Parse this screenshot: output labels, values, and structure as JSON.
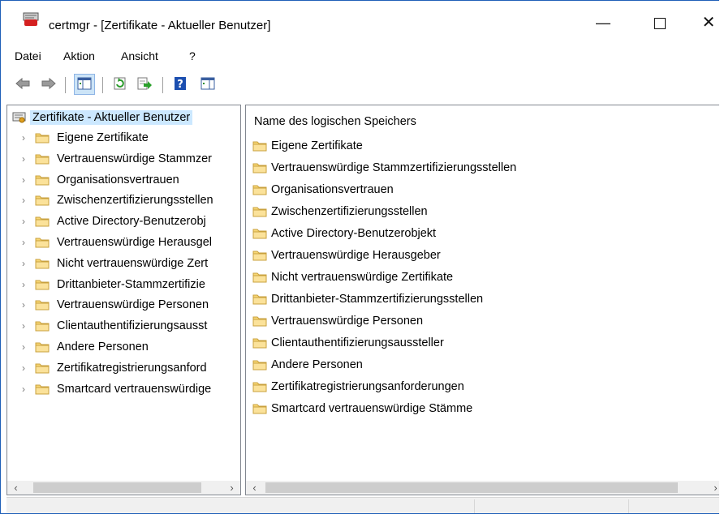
{
  "window": {
    "title": "certmgr - [Zertifikate - Aktueller Benutzer]",
    "controls": [
      "minimize-icon",
      "maximize-icon",
      "close-icon"
    ]
  },
  "menu": [
    "Datei",
    "Aktion",
    "Ansicht",
    "?"
  ],
  "toolbar": {
    "icons": [
      "back-arrow-icon",
      "forward-arrow-icon",
      "show-hide-tree-icon",
      "refresh-icon",
      "export-list-icon",
      "help-icon",
      "action-pane-icon"
    ]
  },
  "tree": {
    "root": "Zertifikate - Aktueller Benutzer",
    "items": [
      "Eigene Zertifikate",
      "Vertrauenswürdige Stammzer",
      "Organisationsvertrauen",
      "Zwischenzertifizierungsstellen",
      "Active Directory-Benutzerobj",
      "Vertrauenswürdige Herausgel",
      "Nicht vertrauenswürdige Zert",
      "Drittanbieter-Stammzertifizie",
      "Vertrauenswürdige Personen",
      "Clientauthentifizierungsausst",
      "Andere Personen",
      "Zertifikatregistrierungsanford",
      "Smartcard vertrauenswürdige"
    ]
  },
  "list": {
    "column_header": "Name des logischen Speichers",
    "items": [
      "Eigene Zertifikate",
      "Vertrauenswürdige Stammzertifizierungsstellen",
      "Organisationsvertrauen",
      "Zwischenzertifizierungsstellen",
      "Active Directory-Benutzerobjekt",
      "Vertrauenswürdige Herausgeber",
      "Nicht vertrauenswürdige Zertifikate",
      "Drittanbieter-Stammzertifizierungsstellen",
      "Vertrauenswürdige Personen",
      "Clientauthentifizierungsaussteller",
      "Andere Personen",
      "Zertifikatregistrierungsanforderungen",
      "Smartcard vertrauenswürdige Stämme"
    ]
  },
  "colors": {
    "selection": "#cce8ff",
    "window_border": "#1f5fb8",
    "folder": "#f8d775"
  }
}
